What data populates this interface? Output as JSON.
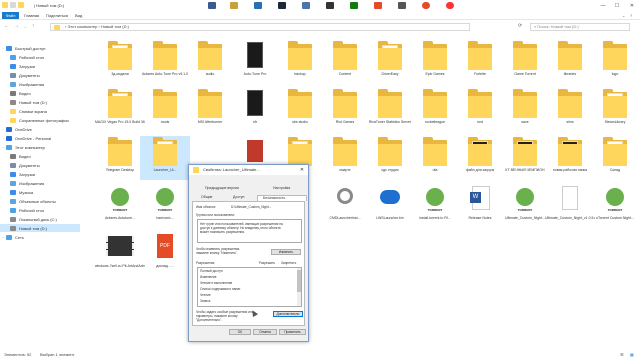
{
  "window": {
    "title": "| Новый том (D:)",
    "controls": [
      "—",
      "☐",
      "✕"
    ]
  },
  "ribbon": {
    "tabs": [
      "Файл",
      "Главная",
      "Поделиться",
      "Вид"
    ],
    "accent": "#1979ca"
  },
  "nav": {
    "back": "←",
    "forward": "→",
    "up": "↑",
    "address": "› Этот компьютер › Новый том (D:)",
    "search_placeholder": "Поиск: Новый том (D:)"
  },
  "sidebar": {
    "items": [
      {
        "label": "Быстрый доступ",
        "icon": "star-icon",
        "color": "#3b8ee8",
        "level": 0,
        "selected": false
      },
      {
        "label": "Рабочий стол",
        "icon": "desktop-icon",
        "color": "#4aa3e8",
        "level": 1,
        "selected": false
      },
      {
        "label": "Загрузки",
        "icon": "download-icon",
        "color": "#3b8ee8",
        "level": 1,
        "selected": false
      },
      {
        "label": "Документы",
        "icon": "documents-icon",
        "color": "#7a8da6",
        "level": 1,
        "selected": false
      },
      {
        "label": "Изображения",
        "icon": "pictures-icon",
        "color": "#5aa6dd",
        "level": 1,
        "selected": false
      },
      {
        "label": "Видео",
        "icon": "video-icon",
        "color": "#7a7a7a",
        "level": 1,
        "selected": false
      },
      {
        "label": "Новый том (D:)",
        "icon": "drive-icon",
        "color": "#8a8a8a",
        "level": 1,
        "selected": false
      },
      {
        "label": "Снимки экрана",
        "icon": "folder-icon",
        "color": "#ffd65c",
        "level": 1,
        "selected": false
      },
      {
        "label": "Сохраненные фотографии",
        "icon": "folder-icon",
        "color": "#ffd65c",
        "level": 1,
        "selected": false
      },
      {
        "label": "OneDrive",
        "icon": "cloud-icon",
        "color": "#1f6fd1",
        "level": 0,
        "selected": false
      },
      {
        "label": "OneDrive - Personal",
        "icon": "cloud-icon",
        "color": "#1f6fd1",
        "level": 0,
        "selected": false
      },
      {
        "label": "Этот компьютер",
        "icon": "computer-icon",
        "color": "#4aa3e8",
        "level": 0,
        "selected": false
      },
      {
        "label": "Видео",
        "icon": "video-icon",
        "color": "#7a7a7a",
        "level": 1,
        "selected": false
      },
      {
        "label": "Документы",
        "icon": "documents-icon",
        "color": "#7a8da6",
        "level": 1,
        "selected": false
      },
      {
        "label": "Загрузки",
        "icon": "download-icon",
        "color": "#3b8ee8",
        "level": 1,
        "selected": false
      },
      {
        "label": "Изображения",
        "icon": "pictures-icon",
        "color": "#5aa6dd",
        "level": 1,
        "selected": false
      },
      {
        "label": "Музыка",
        "icon": "music-icon",
        "color": "#3b8ee8",
        "level": 1,
        "selected": false
      },
      {
        "label": "Объемные объекты",
        "icon": "3d-objects-icon",
        "color": "#5aa6dd",
        "level": 1,
        "selected": false
      },
      {
        "label": "Рабочий стол",
        "icon": "desktop-icon",
        "color": "#4aa3e8",
        "level": 1,
        "selected": false
      },
      {
        "label": "Локальный диск (C:)",
        "icon": "drive-icon",
        "color": "#8a8a8a",
        "level": 1,
        "selected": false
      },
      {
        "label": "Новый том (D:)",
        "icon": "drive-icon",
        "color": "#8a8a8a",
        "level": 1,
        "selected": true
      },
      {
        "label": "Сеть",
        "icon": "network-icon",
        "color": "#4aa3e8",
        "level": 0,
        "selected": false
      }
    ]
  },
  "files": [
    {
      "name": "3д-модели",
      "kind": "folder-doc"
    },
    {
      "name": "Antares Auto-Tune Pro v9.1.0",
      "kind": "folder"
    },
    {
      "name": "audio",
      "kind": "folder"
    },
    {
      "name": "Auto-Tune Pro",
      "kind": "app-dark"
    },
    {
      "name": "backup",
      "kind": "folder"
    },
    {
      "name": "Content",
      "kind": "folder"
    },
    {
      "name": "DriverEasy",
      "kind": "folder-doc"
    },
    {
      "name": "Epic Games",
      "kind": "folder"
    },
    {
      "name": "Fortnite",
      "kind": "folder"
    },
    {
      "name": "Game Torrent",
      "kind": "folder"
    },
    {
      "name": "libraries",
      "kind": "folder"
    },
    {
      "name": "logo",
      "kind": "folder"
    },
    {
      "name": "MAGIX Vegas Pro 15.0 Build 361 RePack by KpoJIuK",
      "kind": "folder-doc"
    },
    {
      "name": "mods",
      "kind": "folder"
    },
    {
      "name": "MSI Afterburner",
      "kind": "folder"
    },
    {
      "name": "nfr",
      "kind": "app-dark"
    },
    {
      "name": "obs studio",
      "kind": "folder"
    },
    {
      "name": "Riot Games",
      "kind": "folder"
    },
    {
      "name": "RivaTuner Statistics Server",
      "kind": "folder"
    },
    {
      "name": "rocketleague",
      "kind": "folder"
    },
    {
      "name": "rust",
      "kind": "folder"
    },
    {
      "name": "save",
      "kind": "folder"
    },
    {
      "name": "sims",
      "kind": "folder"
    },
    {
      "name": "SteamLibrary",
      "kind": "folder-doc"
    },
    {
      "name": "Telegram Desktop",
      "kind": "folder"
    },
    {
      "name": "Launcher_Ui...",
      "kind": "folder-selected"
    },
    {
      "name": "",
      "kind": "hidden"
    },
    {
      "name": "",
      "kind": "app-red"
    },
    {
      "name": "",
      "kind": "folder-doc"
    },
    {
      "name": "смартс",
      "kind": "folder"
    },
    {
      "name": "сдс студио",
      "kind": "folder"
    },
    {
      "name": "ufa",
      "kind": "folder"
    },
    {
      "name": "файл для загрузк",
      "kind": "folder-img"
    },
    {
      "name": "КТ ВЕЧНЫЙ ЧЕМПИОН",
      "kind": "folder-img"
    },
    {
      "name": "новая рабочая папка",
      "kind": "folder-img"
    },
    {
      "name": "Склад",
      "kind": "folder-doc"
    },
    {
      "name": "Antares.Autotune...",
      "kind": "torrent"
    },
    {
      "name": "harmonic...",
      "kind": "torrent"
    },
    {
      "name": "",
      "kind": "hidden"
    },
    {
      "name": "",
      "kind": "hidden"
    },
    {
      "name": "",
      "kind": "hidden"
    },
    {
      "name": "CMDLauncherInst...",
      "kind": "gear"
    },
    {
      "name": "LWSLauncher.bin",
      "kind": "dots"
    },
    {
      "name": "install-torrent-in Fil...",
      "kind": "torrent"
    },
    {
      "name": "Release Notes",
      "kind": "word"
    },
    {
      "name": "Ultimate_Custom_Night...",
      "kind": "torrent"
    },
    {
      "name": "Ultimate_Custom_Night_v1.0.5.rfolder",
      "kind": "doc"
    },
    {
      "name": "uTorrent Custom Night...",
      "kind": "torrent"
    },
    {
      "name": "windows-7sell.cu Pit-ArtAndAdmin...Bar-Yoda-Smoke.FIX",
      "kind": "video"
    },
    {
      "name": "доклад - ...",
      "kind": "pdf"
    }
  ],
  "dialog": {
    "title": "Свойства: Launcher_Ultimate...",
    "close": "✕",
    "tabs_row1": [
      "Предыдущие версии",
      "Настройка"
    ],
    "tabs_row2": [
      "Общие",
      "Доступ",
      "Безопасность"
    ],
    "object_label": "Имя объекта:",
    "object_path": "D:\\Ultimate_Custom_Night...",
    "groups_label": "Группы или пользователи:",
    "groups_text": [
      "Нет групп или пользователей, имеющих разрешения на",
      "доступ к данному объекту. Но владелец этого объекта",
      "может назначить разрешения."
    ],
    "change_hint": [
      "Чтобы изменить разрешения,",
      "нажмите кнопку \"Изменить\"."
    ],
    "change_button": "Изменить",
    "perm_label": "Разрешения",
    "allow_label": "Разрешить",
    "deny_label": "Запретить",
    "permissions": [
      "Полный доступ",
      "Изменение",
      "Чтение и выполнение",
      "Список содержимого папки",
      "Чтение",
      "Запись"
    ],
    "advanced_hint": [
      "Чтобы задать особые разрешения или",
      "параметры, нажмите кнопку",
      "\"Дополнительно\"."
    ],
    "advanced_button": "Дополнительно",
    "ok_button": "OK",
    "cancel_button": "Отмена",
    "apply_button": "Применить"
  },
  "status": {
    "elements": "Элементов: 52",
    "selected": "Выбран 1 элемент"
  }
}
